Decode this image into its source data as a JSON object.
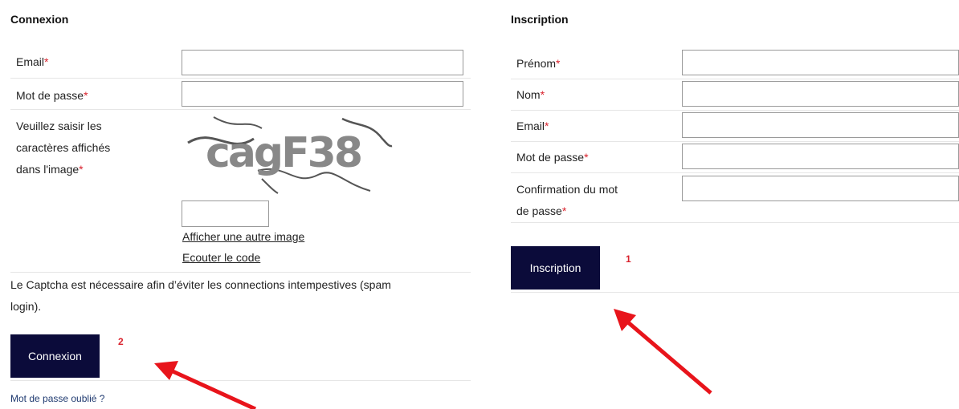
{
  "login": {
    "title": "Connexion",
    "email_label": "Email",
    "password_label": "Mot de passe",
    "captcha_label_lines": [
      "Veuillez saisir les",
      "caractères affichés",
      "dans l'image"
    ],
    "required_marker": "*",
    "captcha_image_text": "cagF38",
    "captcha_input_value": "",
    "show_other_image_link": "Afficher une autre image",
    "listen_code_link": "Ecouter le code",
    "captcha_note_lines": [
      "Le Captcha est nécessaire afin d’éviter les connections intempestives (spam",
      "login)."
    ],
    "submit_label": "Connexion",
    "submit_annotation": "2",
    "forgot_password_link": "Mot de passe oublié ?"
  },
  "signup": {
    "title": "Inscription",
    "firstname_label": "Prénom",
    "lastname_label": "Nom",
    "email_label": "Email",
    "password_label": "Mot de passe",
    "confirm_label_lines": [
      "Confirmation du mot",
      "de passe"
    ],
    "required_marker": "*",
    "submit_label": "Inscription",
    "submit_annotation": "1"
  },
  "colors": {
    "button_bg": "#0b0b3a",
    "required": "#d9232e",
    "annotation_arrow": "#e8141b"
  },
  "annotations": {
    "arrow_icon": "red-arrow-icon"
  }
}
